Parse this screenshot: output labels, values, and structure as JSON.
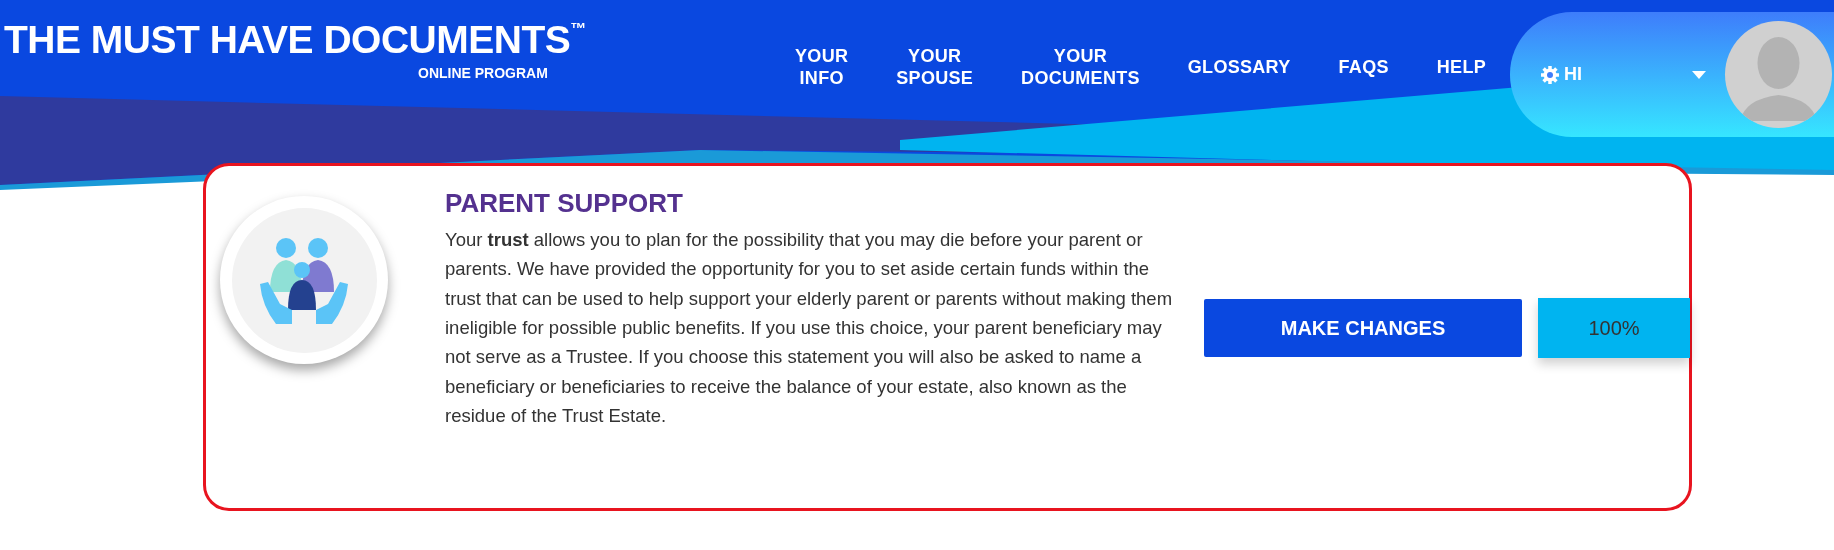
{
  "header": {
    "logo": "THE MUST HAVE DOCUMENTS$^{™}$",
    "subtitle": "ONLINE PROGRAM",
    "nav": [
      {
        "label": "YOUR INFO"
      },
      {
        "label": "YOUR SPOUSE"
      },
      {
        "label": "YOUR DOCUMENTS"
      },
      {
        "label": "GLOSSARY"
      },
      {
        "label": "FAQS"
      },
      {
        "label": "HELP"
      }
    ],
    "user_menu": {
      "greeting": "HI"
    }
  },
  "card": {
    "title": "PARENT SUPPORT",
    "body": "Your **trust** allows you to plan for the possibility that you may die before your parent or parents. We have provided the opportunity for you to set aside certain funds within the trust that can be used to help support your elderly parent or parents without making them ineligible for possible public benefits. If you use this choice, your parent beneficiary may not serve as a Trustee. If you choose this statement you will also be asked to name a beneficiary or beneficiaries to receive the balance of your estate, also known as the residue of the Trust Estate.",
    "button": "MAKE CHANGES",
    "progress": "100%"
  }
}
